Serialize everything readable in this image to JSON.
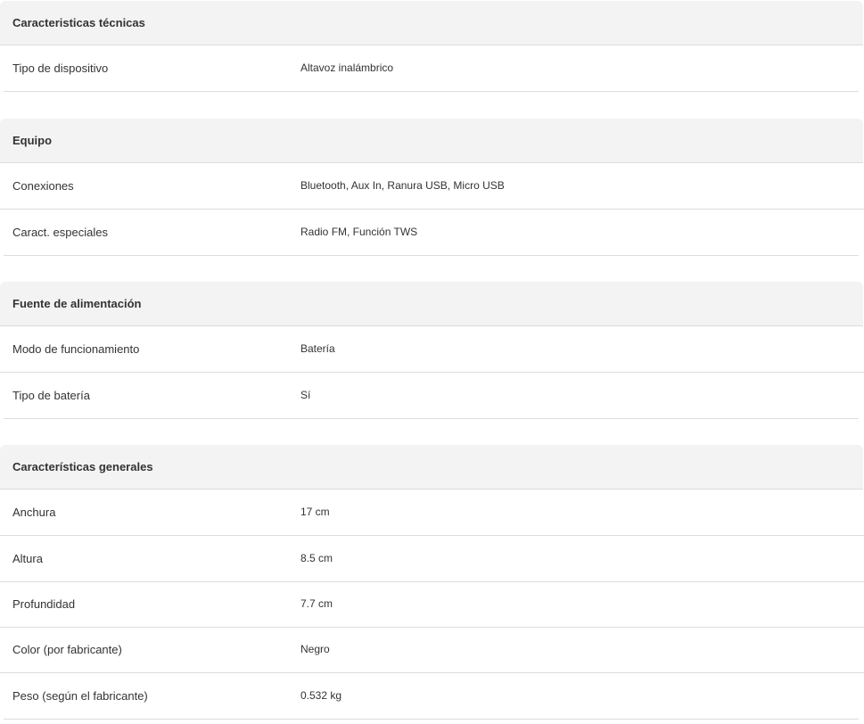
{
  "sections": [
    {
      "title": "Caracteristicas técnicas",
      "rows": [
        {
          "label": "Tipo de dispositivo",
          "value": "Altavoz inalámbrico"
        }
      ]
    },
    {
      "title": "Equipo",
      "rows": [
        {
          "label": "Conexiones",
          "value": "Bluetooth, Aux In, Ranura USB, Micro USB"
        },
        {
          "label": "Caract. especiales",
          "value": "Radio FM, Función TWS"
        }
      ]
    },
    {
      "title": "Fuente de alimentación",
      "rows": [
        {
          "label": "Modo de funcionamiento",
          "value": "Batería"
        },
        {
          "label": "Tipo de batería",
          "value": "Sí"
        }
      ]
    },
    {
      "title": "Características generales",
      "rows": [
        {
          "label": "Anchura",
          "value": "17 cm"
        },
        {
          "label": "Altura",
          "value": "8.5 cm"
        },
        {
          "label": "Profundidad",
          "value": "7.7 cm"
        },
        {
          "label": "Color (por fabricante)",
          "value": "Negro"
        },
        {
          "label": "Peso (según el fabricante)",
          "value": "0.532 kg"
        }
      ]
    }
  ]
}
